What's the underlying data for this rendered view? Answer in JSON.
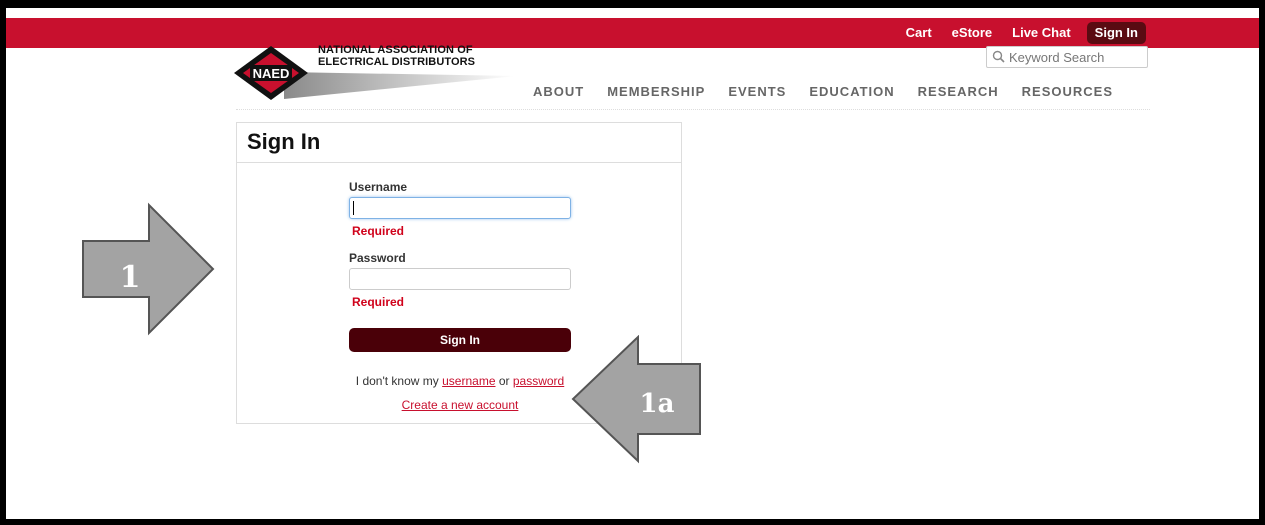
{
  "topnav": {
    "cart": "Cart",
    "estore": "eStore",
    "live_chat": "Live Chat",
    "sign_in": "Sign In"
  },
  "logo": {
    "badge": "NAED",
    "line1": "NATIONAL ASSOCIATION OF",
    "line2": "ELECTRICAL DISTRIBUTORS"
  },
  "search": {
    "placeholder": "Keyword Search"
  },
  "mainnav": [
    "ABOUT",
    "MEMBERSHIP",
    "EVENTS",
    "EDUCATION",
    "RESEARCH",
    "RESOURCES"
  ],
  "form": {
    "title": "Sign In",
    "username_label": "Username",
    "username_value": "",
    "username_error": "Required",
    "password_label": "Password",
    "password_value": "",
    "password_error": "Required",
    "submit": "Sign In",
    "help_prefix": "I don't know my",
    "help_username": "username",
    "help_or": "or",
    "help_password": "password",
    "create_account": "Create a new account"
  },
  "annotations": {
    "arrow1": "1",
    "arrow1a": "1a",
    "arrow_fill": "#a3a3a3"
  },
  "colors": {
    "brand_red": "#c8102e",
    "dark_red": "#4a0008",
    "error_red": "#d0021b"
  }
}
